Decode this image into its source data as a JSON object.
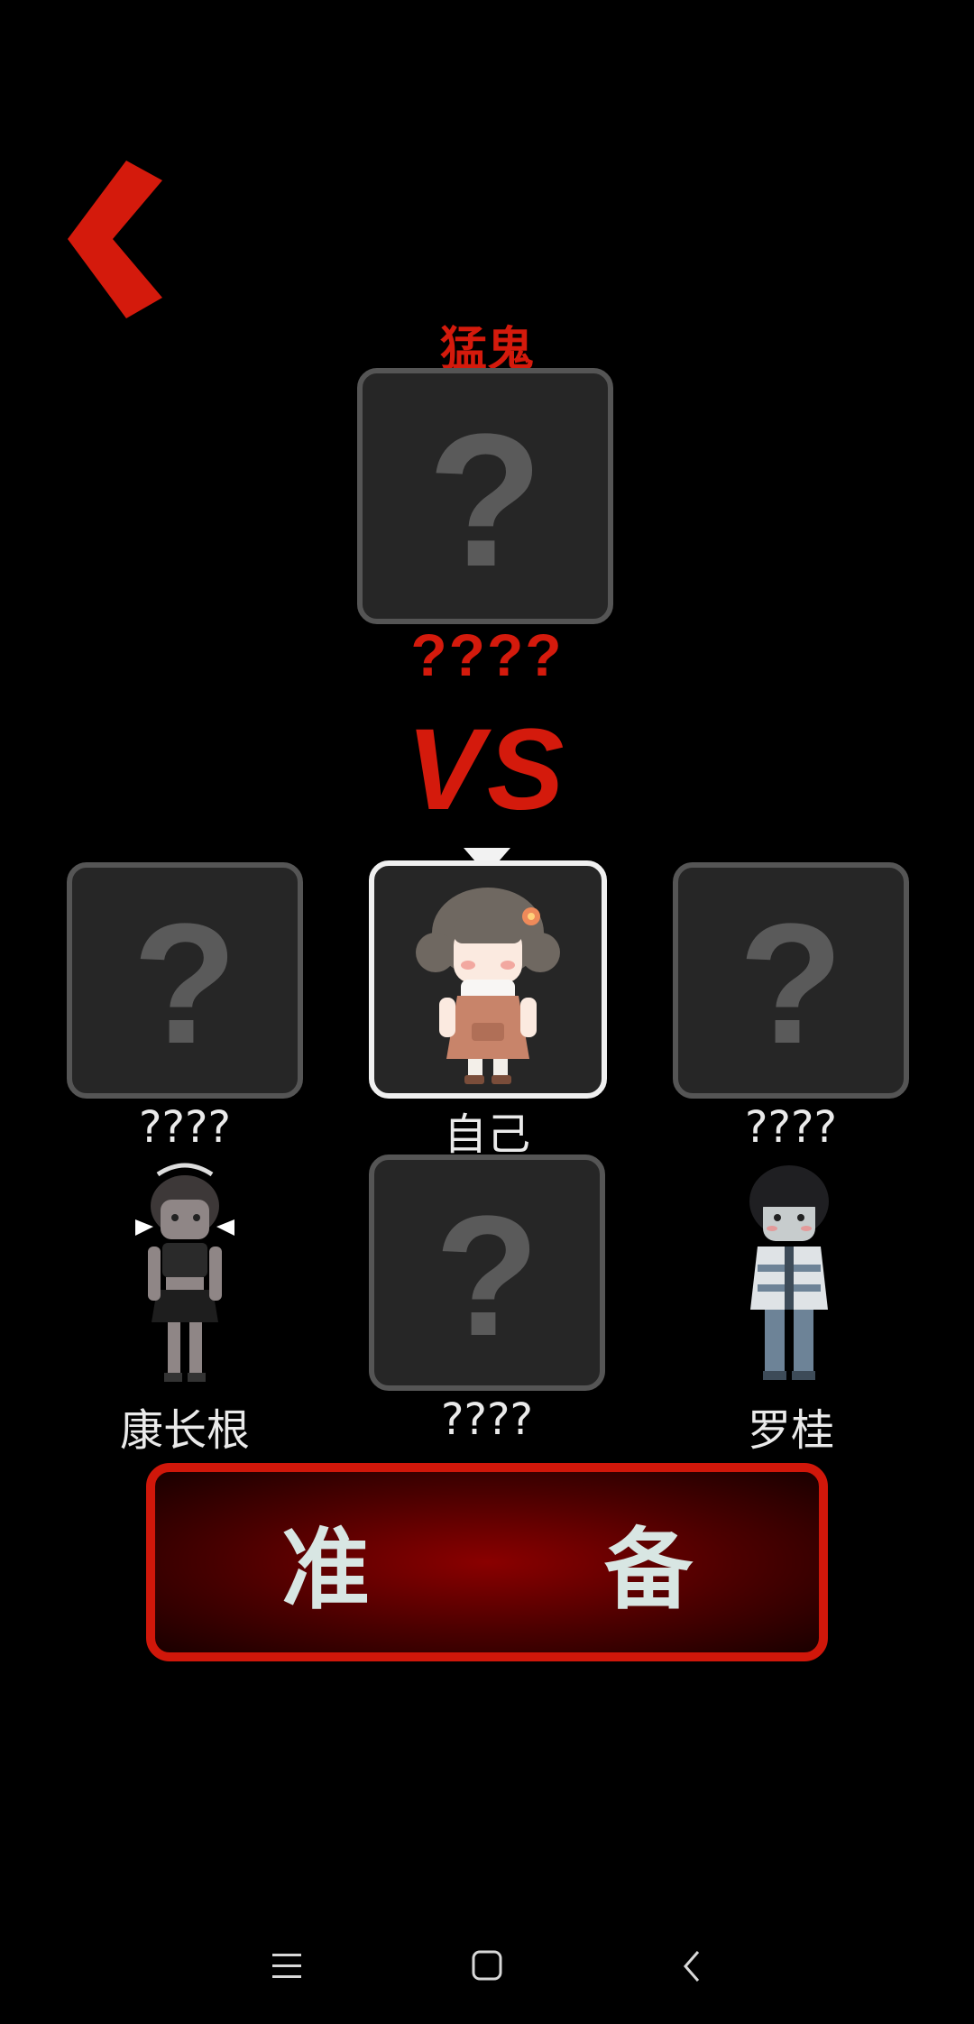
{
  "header": {
    "back_icon": "chevron-left-icon",
    "ghost_label": "猛鬼"
  },
  "ghost": {
    "slot_symbol": "?",
    "name": "????"
  },
  "vs_text": "VS",
  "players": [
    {
      "id": "left",
      "name": "????",
      "revealed": false,
      "symbol": "?"
    },
    {
      "id": "self",
      "name": "自己",
      "revealed": true,
      "selected": true
    },
    {
      "id": "right",
      "name": "????",
      "revealed": false,
      "symbol": "?"
    },
    {
      "id": "kang",
      "name": "康长根",
      "revealed": true
    },
    {
      "id": "bottom",
      "name": "????",
      "revealed": false,
      "symbol": "?"
    },
    {
      "id": "luo",
      "name": "罗桂",
      "revealed": true
    }
  ],
  "ready_button": {
    "char1": "准",
    "char2": "备"
  },
  "nav": {
    "menu_icon": "menu-icon",
    "home_icon": "home-icon",
    "back_icon": "back-icon"
  },
  "colors": {
    "accent_red": "#d41a0c",
    "slot_bg": "#262626",
    "slot_border": "#555555",
    "selected_border": "#f0f0f0"
  }
}
